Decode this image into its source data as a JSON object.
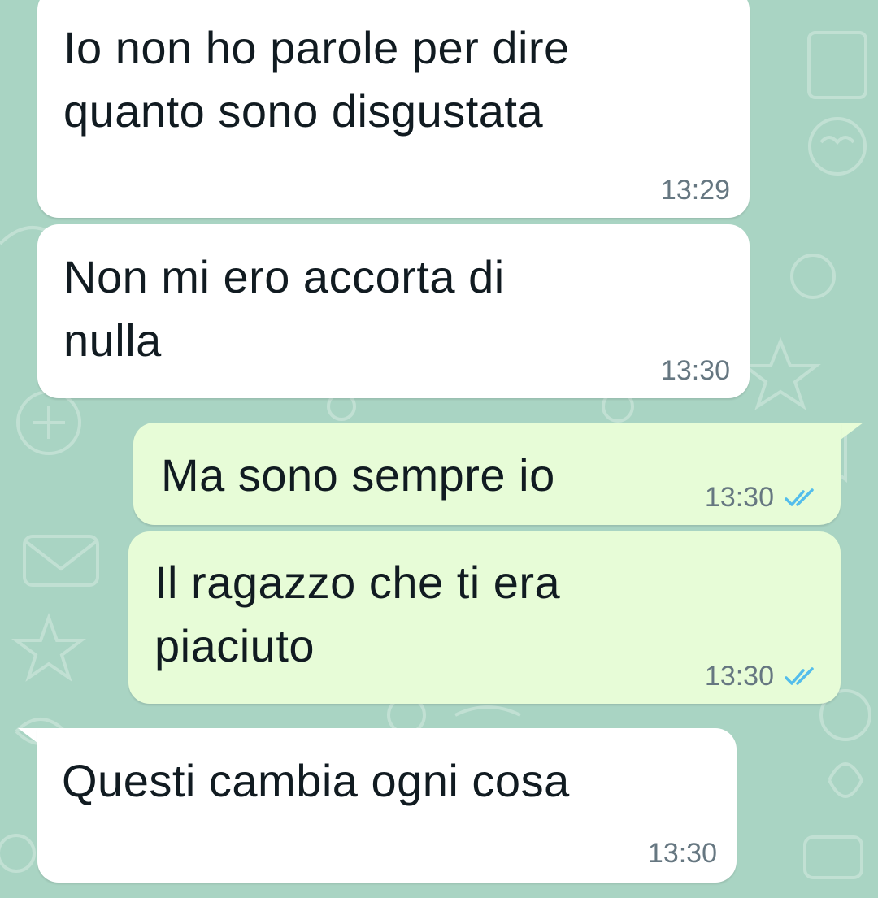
{
  "conversation": {
    "messages": [
      {
        "direction": "incoming",
        "lines": [
          "Io non ho parole per dire",
          "quanto sono disgustata"
        ],
        "time": "13:29"
      },
      {
        "direction": "incoming",
        "lines": [
          "Non mi ero accorta di",
          "nulla"
        ],
        "time": "13:30"
      },
      {
        "direction": "outgoing",
        "lines": [
          "Ma sono sempre io"
        ],
        "time": "13:30",
        "status": "read"
      },
      {
        "direction": "outgoing",
        "lines": [
          "Il ragazzo che ti era",
          "piaciuto"
        ],
        "time": "13:30",
        "status": "read"
      },
      {
        "direction": "incoming",
        "lines": [
          "Questi cambia ogni cosa"
        ],
        "time": "13:30"
      }
    ]
  },
  "icons": {
    "read_receipt": "double-check-icon",
    "wallpaper": "doodle-pattern"
  },
  "colors": {
    "background": "#a9d4c3",
    "incoming_bubble": "#ffffff",
    "outgoing_bubble": "#e7fcd7",
    "time_text": "#667781",
    "read_ticks": "#53bdeb"
  }
}
